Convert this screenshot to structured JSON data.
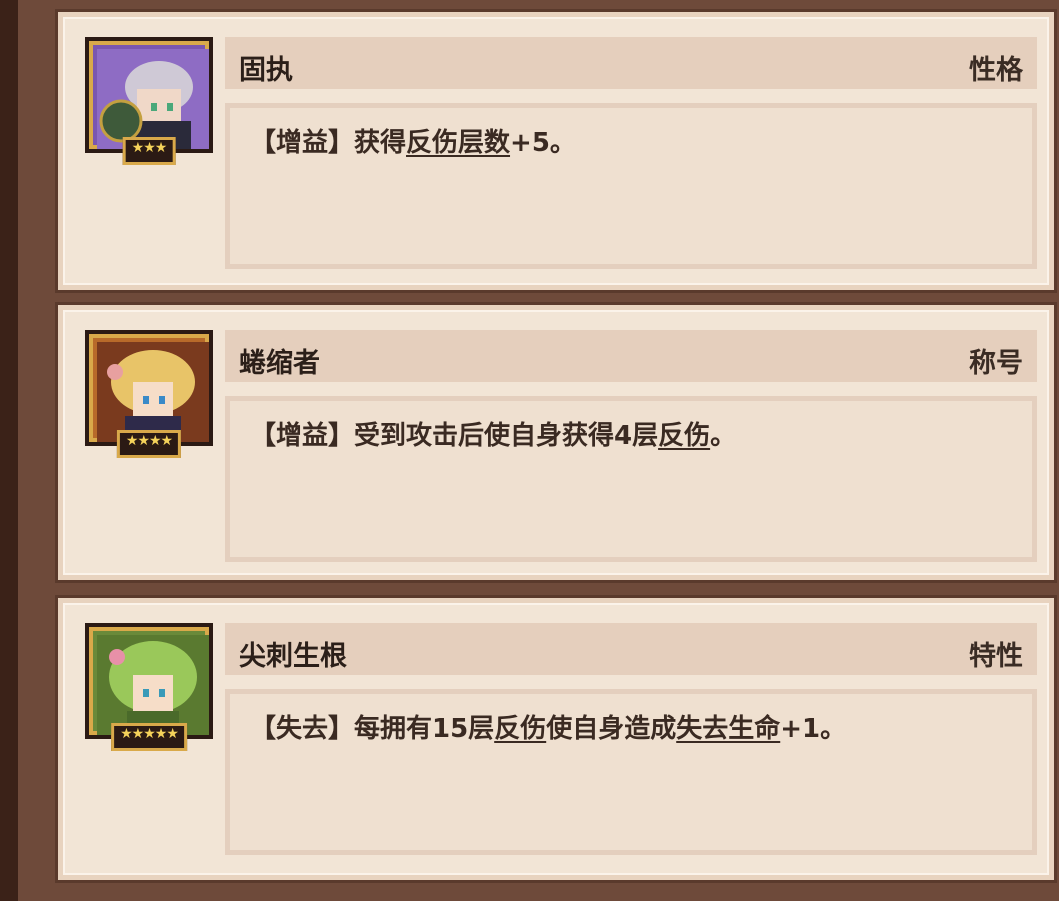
{
  "cards": [
    {
      "name": "固执",
      "tag": "性格",
      "stars": "★★★",
      "desc": [
        {
          "text": "【增益】获得",
          "kw": false
        },
        {
          "text": "反伤层数",
          "kw": true
        },
        {
          "text": "+5。",
          "kw": false
        }
      ]
    },
    {
      "name": "蜷缩者",
      "tag": "称号",
      "stars": "★★★★",
      "desc": [
        {
          "text": "【增益】受到攻击后使自身获得4层",
          "kw": false
        },
        {
          "text": "反伤",
          "kw": true
        },
        {
          "text": "。",
          "kw": false
        }
      ]
    },
    {
      "name": "尖刺生根",
      "tag": "特性",
      "stars": "★★★★★",
      "desc": [
        {
          "text": "【失去】每拥有15层",
          "kw": false
        },
        {
          "text": "反伤",
          "kw": true
        },
        {
          "text": "使自身造成",
          "kw": false
        },
        {
          "text": "失去生命",
          "kw": true
        },
        {
          "text": "+1。",
          "kw": false
        }
      ]
    }
  ],
  "colors": {
    "card_bg": "#f2e5d6",
    "header_bg": "#e5cfbd",
    "frame": "#6e4a3a",
    "star": "#f5d25a"
  }
}
